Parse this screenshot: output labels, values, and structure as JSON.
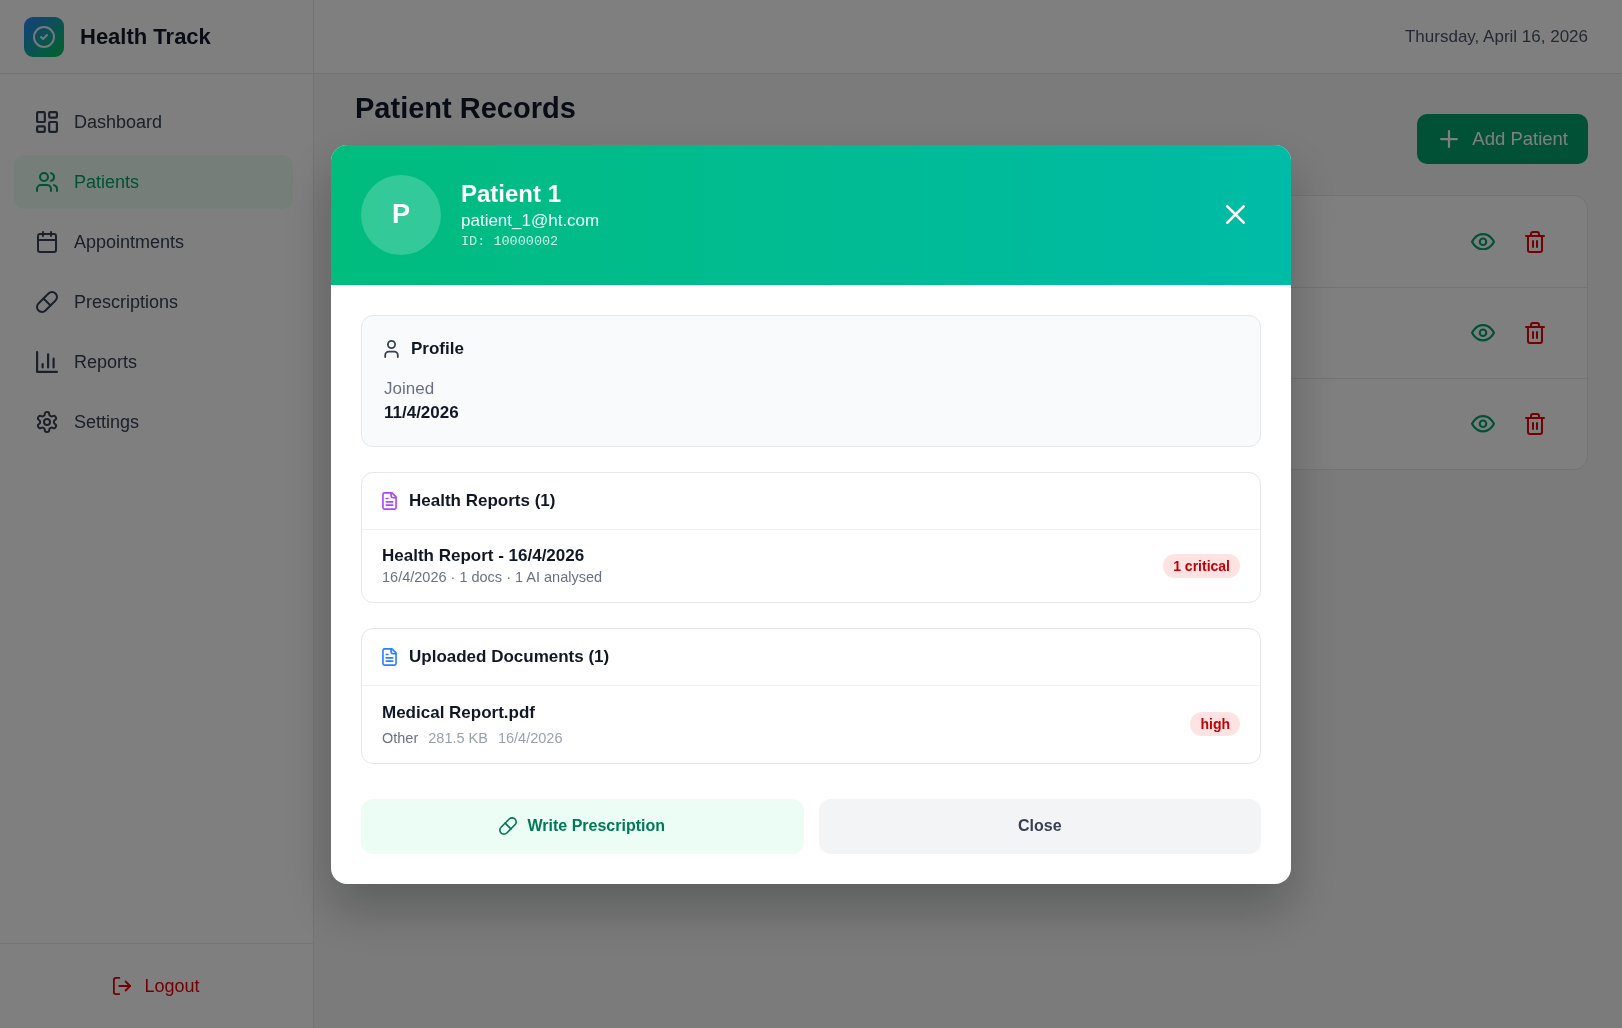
{
  "sidebar": {
    "brand": "Health Track",
    "items": [
      {
        "label": "Dashboard",
        "selected": false
      },
      {
        "label": "Patients",
        "selected": true
      },
      {
        "label": "Appointments",
        "selected": false
      },
      {
        "label": "Prescriptions",
        "selected": false
      },
      {
        "label": "Reports",
        "selected": false
      },
      {
        "label": "Settings",
        "selected": false
      }
    ],
    "logout": "Logout"
  },
  "topbar": {
    "date": "Thursday, April 16, 2026"
  },
  "page": {
    "title": "Patient Records",
    "add_button": "Add Patient",
    "table": {
      "rows": [
        {
          "actions": [
            {
              "kind": "view"
            },
            {
              "kind": "delete"
            }
          ]
        },
        {
          "actions": [
            {
              "kind": "view"
            },
            {
              "kind": "delete"
            }
          ]
        },
        {
          "actions": [
            {
              "kind": "view"
            },
            {
              "kind": "delete"
            }
          ]
        }
      ]
    }
  },
  "patient_modal": {
    "avatar_initial": "P",
    "name": "Patient 1",
    "email": "patient_1@ht.com",
    "patient_id": "ID: 10000002",
    "profile": {
      "title": "Profile",
      "fields": [
        {
          "label": "Joined",
          "value": "11/4/2026"
        }
      ]
    },
    "health_reports": {
      "title": "Health Reports (1)",
      "items": [
        {
          "title": "Health Report - 16/4/2026",
          "meta": "16/4/2026 · 1 docs · 1 AI analysed",
          "badge": "1 critical"
        }
      ]
    },
    "documents": {
      "title": "Uploaded Documents (1)",
      "items": [
        {
          "name": "Medical Report.pdf",
          "category": "Other",
          "size": "281.5 KB",
          "date": "16/4/2026",
          "badge": "high"
        }
      ]
    },
    "buttons": [
      {
        "label": "Write Prescription",
        "kind": "prescription"
      },
      {
        "label": "Close",
        "kind": "close"
      }
    ]
  }
}
